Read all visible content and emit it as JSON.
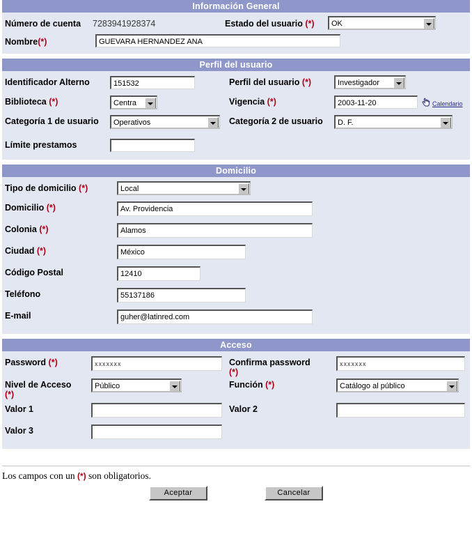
{
  "sections": {
    "general": {
      "title": "Información General",
      "account_label": "Número de cuenta",
      "account_value": "7283941928374",
      "status_label": "Estado del usuario",
      "status_value": "OK",
      "name_label": "Nombre",
      "name_value": "GUEVARA HERNANDEZ ANA"
    },
    "profile": {
      "title": "Perfil del usuario",
      "alt_id_label": "Identificador Alterno",
      "alt_id_value": "151532",
      "profile_label": "Perfil del usuario",
      "profile_value": "Investigador",
      "library_label": "Biblioteca",
      "library_value": "Centra",
      "validity_label": "Vigencia",
      "validity_value": "2003-11-20",
      "calendar_link": "Calendario",
      "cat1_label": "Categoría 1 de usuario",
      "cat1_value": "Operativos",
      "cat2_label": "Categoría 2 de usuario",
      "cat2_value": "D. F.",
      "loan_limit_label": "Límite prestamos",
      "loan_limit_value": ""
    },
    "address": {
      "title": "Domicilio",
      "type_label": "Tipo de domicilio",
      "type_value": "Local",
      "street_label": "Domicilio",
      "street_value": "Av. Providencia",
      "colonia_label": "Colonia",
      "colonia_value": "Alamos",
      "city_label": "Ciudad",
      "city_value": "México",
      "zip_label": "Código Postal",
      "zip_value": "12410",
      "phone_label": "Teléfono",
      "phone_value": "55137186",
      "email_label": "E-mail",
      "email_value": "guher@latinred.com"
    },
    "access": {
      "title": "Acceso",
      "password_label": "Password",
      "password_value": "xxxxxxx",
      "confirm_label": "Confirma password",
      "confirm_value": "xxxxxxx",
      "level_label": "Nivel de Acceso",
      "level_value": "Público",
      "function_label": "Función",
      "function_value": "Catálogo al público",
      "valor1_label": "Valor 1",
      "valor1_value": "",
      "valor2_label": "Valor 2",
      "valor2_value": "",
      "valor3_label": "Valor 3",
      "valor3_value": ""
    }
  },
  "required_marker": "(*)",
  "footer": {
    "note_prefix": "Los campos con un ",
    "note_marker": "(*)",
    "note_suffix": " son obligatorios.",
    "accept_label": "Aceptar",
    "cancel_label": "Cancelar"
  },
  "colors": {
    "header_bar": "#8e96ca",
    "section_bg": "#e3e7f1",
    "required": "#b00018",
    "link": "#2a2a8c"
  }
}
